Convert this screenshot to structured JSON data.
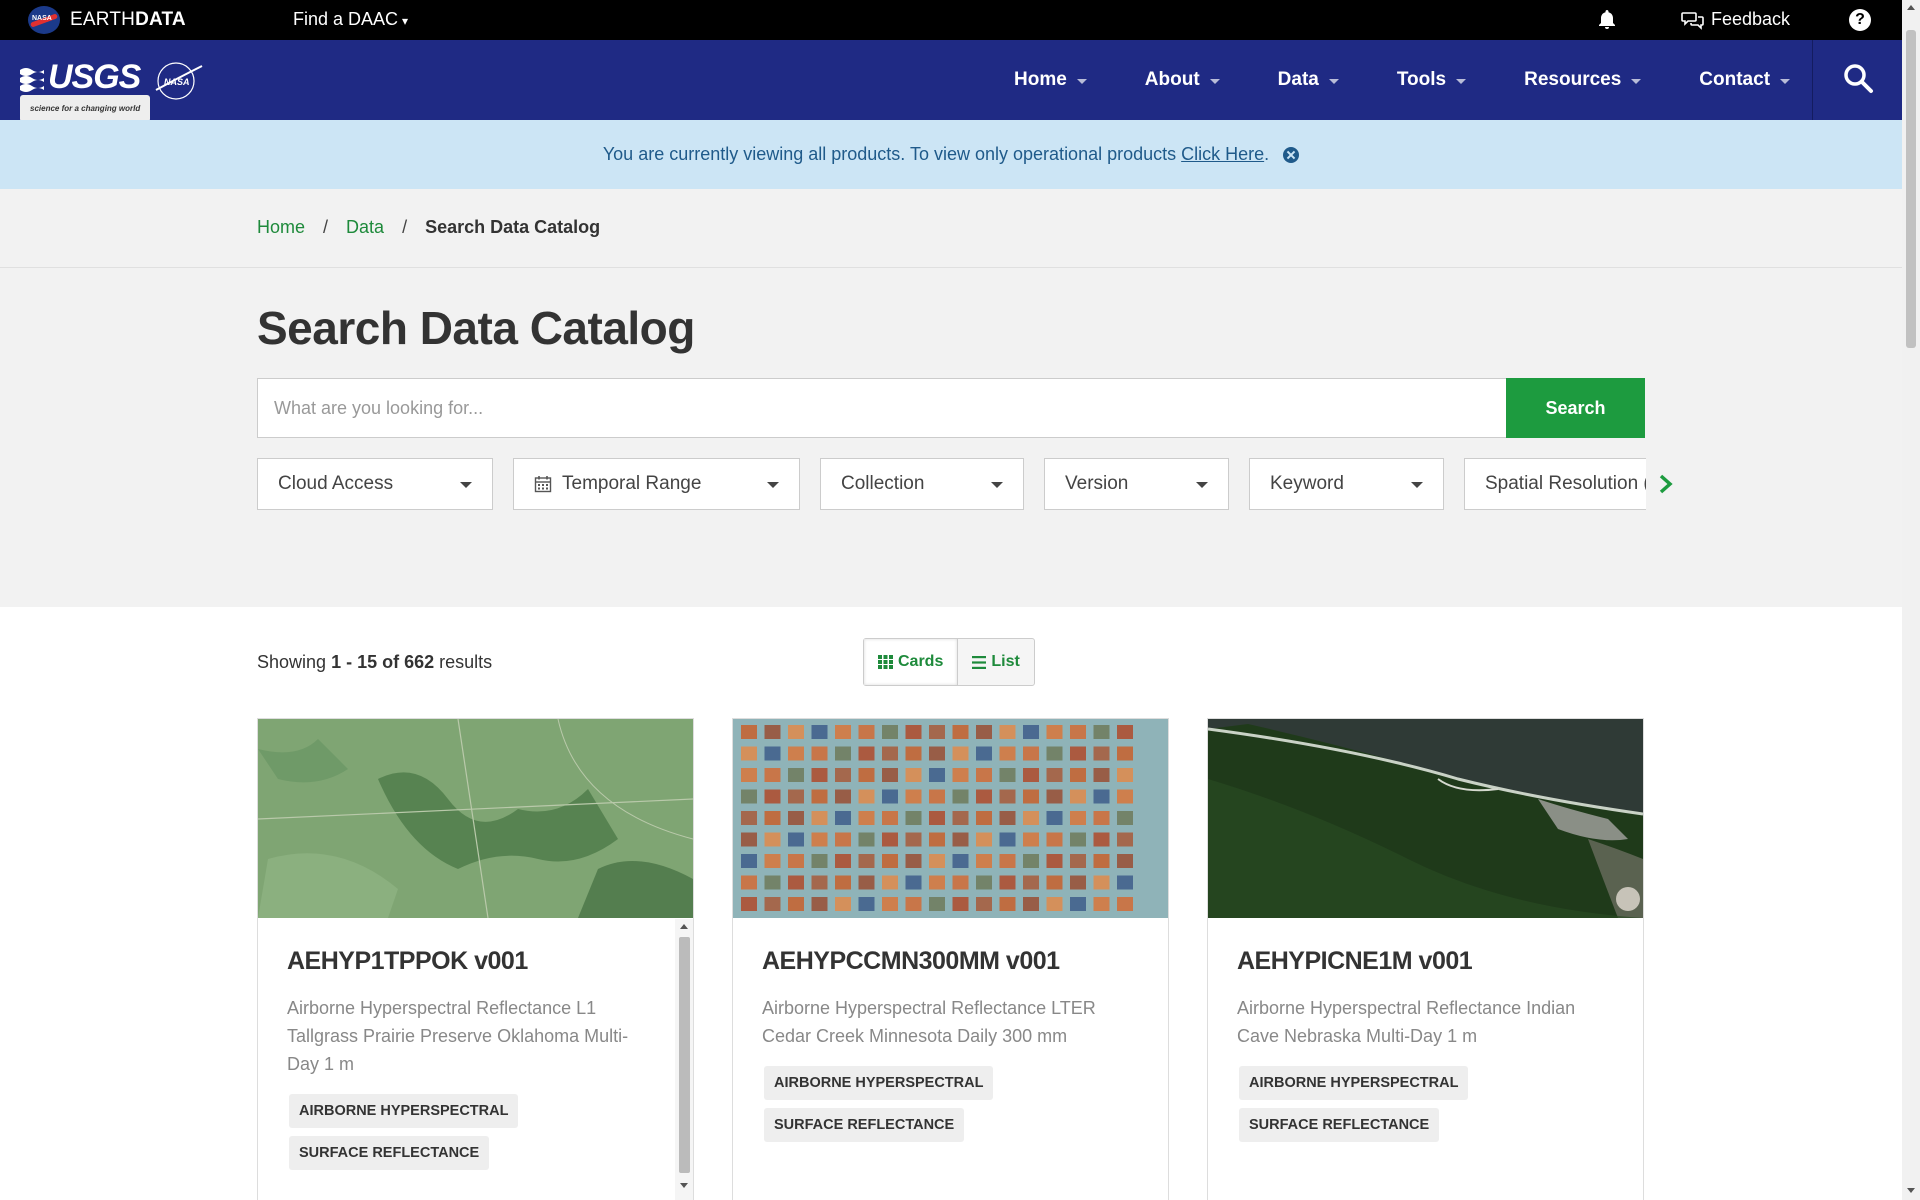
{
  "topbar": {
    "brand_regular": "EARTH",
    "brand_bold": "DATA",
    "find_daac": "Find a DAAC",
    "feedback": "Feedback",
    "help": "?"
  },
  "navbar": {
    "usgs": "USGS",
    "usgs_tagline": "science for a changing world",
    "nasa": "NASA",
    "items": [
      {
        "label": "Home"
      },
      {
        "label": "About"
      },
      {
        "label": "Data"
      },
      {
        "label": "Tools"
      },
      {
        "label": "Resources"
      },
      {
        "label": "Contact"
      }
    ],
    "bg_color": "#1f2a84"
  },
  "alert": {
    "text": "You are currently viewing all products. To view only operational products",
    "link": "Click Here",
    "tail": "."
  },
  "breadcrumb": {
    "home": "Home",
    "data": "Data",
    "current": "Search Data Catalog",
    "separator": "/"
  },
  "page": {
    "title": "Search Data Catalog",
    "search_placeholder": "What are you looking for...",
    "search_button": "Search",
    "accent_color": "#1d9b3f"
  },
  "filters": [
    {
      "label": "Cloud Access"
    },
    {
      "label": "Temporal Range"
    },
    {
      "label": "Collection"
    },
    {
      "label": "Version"
    },
    {
      "label": "Keyword"
    },
    {
      "label": "Spatial Resolution ("
    }
  ],
  "results": {
    "prefix": "Showing",
    "range": "1 - 15 of 662",
    "suffix": "results",
    "view_cards": "Cards",
    "view_list": "List"
  },
  "cards": [
    {
      "title": "AEHYP1TPPOK v001",
      "description": "Airborne Hyperspectral Reflectance L1 Tallgrass Prairie Preserve Oklahoma Multi-Day 1 m",
      "tags": [
        "AIRBORNE HYPERSPECTRAL",
        "SURFACE REFLECTANCE"
      ]
    },
    {
      "title": "AEHYPCCMN300MM v001",
      "description": "Airborne Hyperspectral Reflectance LTER Cedar Creek Minnesota Daily 300 mm",
      "tags": [
        "AIRBORNE HYPERSPECTRAL",
        "SURFACE REFLECTANCE"
      ]
    },
    {
      "title": "AEHYPICNE1M v001",
      "description": "Airborne Hyperspectral Reflectance Indian Cave Nebraska Multi-Day 1 m",
      "tags": [
        "AIRBORNE HYPERSPECTRAL",
        "SURFACE REFLECTANCE"
      ]
    }
  ]
}
